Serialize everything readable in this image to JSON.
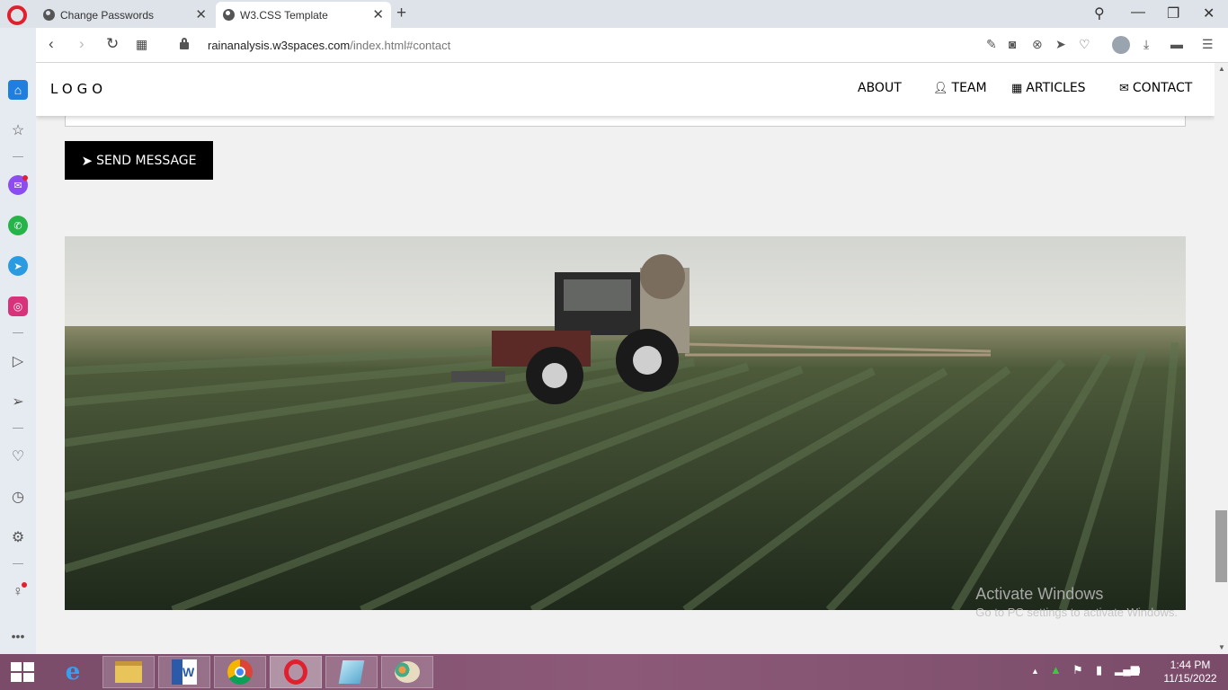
{
  "browser": {
    "tabs": [
      {
        "title": "Change Passwords",
        "active": false
      },
      {
        "title": "W3.CSS Template",
        "active": true
      }
    ],
    "address": {
      "host": "rainanalysis.w3spaces.com",
      "path": "/index.html#contact"
    }
  },
  "site": {
    "logo": "LOGO",
    "nav": [
      {
        "label": "ABOUT",
        "icon": ""
      },
      {
        "label": "TEAM",
        "icon": "user-icon"
      },
      {
        "label": "ARTICLES",
        "icon": "grid-icon"
      },
      {
        "label": "CONTACT",
        "icon": "envelope-icon"
      }
    ],
    "send_button": "SEND MESSAGE",
    "photo": {
      "alt_subject": "tractor-spraying-crop-field"
    }
  },
  "watermark": {
    "title": "Activate Windows",
    "subtitle": "Go to PC settings to activate Windows."
  },
  "taskbar": {
    "apps": [
      "internet-explorer-icon",
      "file-explorer-icon",
      "word-icon",
      "chrome-icon",
      "opera-icon",
      "app-icon",
      "paint-icon"
    ],
    "time": "1:44 PM",
    "date": "11/15/2022"
  },
  "colors": {
    "accent": "#1e7fe0",
    "opera_red": "#e0202f",
    "button_bg": "#000000",
    "page_bg": "#f1f1f1"
  }
}
